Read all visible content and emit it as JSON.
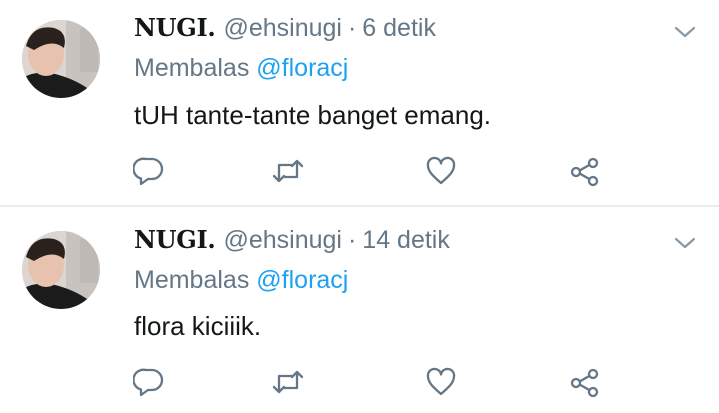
{
  "tweets": [
    {
      "name": "NUGI.",
      "handle": "@ehsinugi",
      "separator": "·",
      "time": "6 detik",
      "reply_prefix": "Membalas",
      "reply_to": "@floracj",
      "text": "tUH tante-tante banget emang."
    },
    {
      "name": "NUGI.",
      "handle": "@ehsinugi",
      "separator": "·",
      "time": "14 detik",
      "reply_prefix": "Membalas",
      "reply_to": "@floracj",
      "text": "flora kiciiik."
    }
  ],
  "icons": {
    "menu": "chevron-down-icon",
    "reply": "reply-icon",
    "retweet": "retweet-icon",
    "like": "heart-icon",
    "share": "share-icon"
  },
  "colors": {
    "text": "#14171a",
    "muted": "#657786",
    "accent": "#1da1f2",
    "divider": "#e6ecf0"
  }
}
